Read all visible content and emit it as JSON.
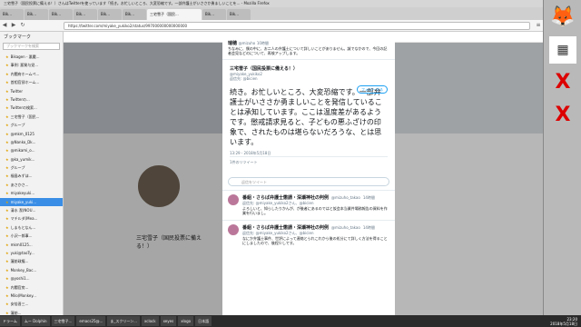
{
  "window": {
    "title": "三宅雪子（国民投票に備える！）さんはTwitterを使っています「続き。お忙しいところ、大変恐縮です。一部弁護士がいささか勇ましいことを… - Mozilla Firefox"
  },
  "tabs": [
    {
      "label": "Bik..."
    },
    {
      "label": "Bik..."
    },
    {
      "label": "Bik..."
    },
    {
      "label": "Bik..."
    },
    {
      "label": "Bik..."
    },
    {
      "label": "Bik..."
    },
    {
      "label": "三宅雪子（国民...",
      "active": true
    },
    {
      "label": "Bik..."
    },
    {
      "label": "Bik..."
    }
  ],
  "nav": {
    "url": "https://twitter.com/miyake_yukiko2/status/997000000000000000"
  },
  "sidebar": {
    "header": "ブックマーク",
    "search_placeholder": "ブックマークを検索",
    "items": [
      {
        "label": "Bikagen - 悪魔..."
      },
      {
        "label": "事例: 悪質与党..."
      },
      {
        "label": "内閣府ホームペ..."
      },
      {
        "label": "首相官邸ホーム..."
      },
      {
        "label": "Twitter"
      },
      {
        "label": "Twitterの..."
      },
      {
        "label": "Twitterの検索..."
      },
      {
        "label": "三宅雪子（国民..."
      },
      {
        "label": "グループ"
      },
      {
        "label": "@mkm_0125"
      },
      {
        "label": "@Nanko_Dk..."
      },
      {
        "label": "@mikami_o..."
      },
      {
        "label": "@ka_yumik..."
      },
      {
        "label": "グループ"
      },
      {
        "label": "福島みずほ..."
      },
      {
        "label": "あさかさ..."
      },
      {
        "label": "miyakeyuki..."
      },
      {
        "label": "miyake_yuki..."
      },
      {
        "label": "清水 潔(NOU..."
      },
      {
        "label": "マチルダ(Mea..."
      },
      {
        "label": "しまもとなん..."
      },
      {
        "label": "小沢一郎事..."
      },
      {
        "label": "mkm0125..."
      },
      {
        "label": "yuki@taoTy..."
      },
      {
        "label": "蓮舫政権..."
      },
      {
        "label": "Monkey_Bac..."
      },
      {
        "label": "@yoshi1..."
      },
      {
        "label": "内閣官房..."
      },
      {
        "label": "Milo(Monkey..."
      },
      {
        "label": "安倍晋三..."
      },
      {
        "label": "蓮舫..."
      }
    ],
    "selected_index": 17
  },
  "profile": {
    "name": "三宅雪子（国民投票に備える！）",
    "handle": "@miyake_yukiko2"
  },
  "tweet_modal": {
    "top_reply": {
      "name": "瑞穂",
      "handle": "@mizuho",
      "time": "10時間",
      "text": "ちなみに、僕の中に、お二人の弁護士について詳しいことがありません。誠でなかので、今回の記者会見などのについて、再検アップします。"
    },
    "author": {
      "name": "三宅雪子（国民投票に備える！）",
      "handle": "@miyake_yukiko2",
      "follow_label": "フォローする"
    },
    "reply_to": "返信先: @bicien",
    "text": "続き。お忙しいところ、大変恐縮です。一部弁護士がいささか勇ましいことを発信していることは承知しています。ここは温度差があるようです。懲戒請求見ると、子どもの悪ふざけの印象で、されたものは堪らないだろうな、とは思います。",
    "timestamp": "13:29 - 2018年5月18日",
    "retweets_line": "1件のリツイート",
    "reply_placeholder": "返信をツイート",
    "replies": [
      {
        "name": "番組・さらば弁護士懲請・深瀬神社の判例",
        "handle": "@mizuho_takao",
        "time": "14時間",
        "reply_to": "返信先: @miyake_yukiko2さん、@bicien",
        "text": "よろしいと、知らしたりかんが、が後者にあるのではと仮会本当業件場務報告の資料を作業を行いまし。"
      },
      {
        "name": "番組・さらば弁護士懲請・深瀬神社の判例",
        "handle": "@mizuho_takao",
        "time": "14時間",
        "reply_to": "返信先: @miyake_yukiko2さん、@bicien",
        "text": "なにか弁護士事件、世評によって連絡とられこれから後の処分にて詳しく方法を得ることにしましたので、後程少しです。"
      }
    ]
  },
  "dock": {
    "icons": [
      "fox-icon",
      "calendar-icon",
      "x-red-icon",
      "x-red-icon"
    ]
  },
  "taskbar": {
    "items": [
      {
        "label": "ドラーム"
      },
      {
        "label": "ムー Dolphin"
      },
      {
        "label": "三宅雪子..."
      },
      {
        "label": "emacs25@..."
      },
      {
        "label": "ま_スクリーン..."
      },
      {
        "label": "xclock"
      },
      {
        "label": "xeyes"
      },
      {
        "label": "xlogo"
      },
      {
        "label": "日本語"
      }
    ],
    "clock_time": "23:20",
    "clock_date": "2018年5月18日"
  }
}
